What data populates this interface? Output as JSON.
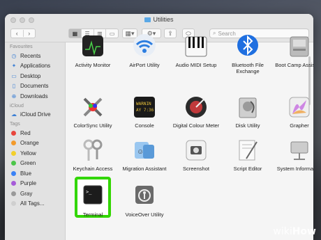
{
  "window": {
    "title": "Utilities",
    "search_placeholder": "Search"
  },
  "toolbar": {
    "back_label": "‹",
    "forward_label": "›",
    "view_icons": [
      "▦",
      "☰",
      "▥",
      "▭"
    ],
    "group_label": "▦▾",
    "action_label": "⚙▾",
    "share_label": "⇪",
    "tag_label": "⬭"
  },
  "sidebar": {
    "favourites_heading": "Favourites",
    "favourites": [
      {
        "label": "Recents",
        "icon": "clock-icon"
      },
      {
        "label": "Applications",
        "icon": "applications-icon"
      },
      {
        "label": "Desktop",
        "icon": "desktop-icon"
      },
      {
        "label": "Documents",
        "icon": "document-icon"
      },
      {
        "label": "Downloads",
        "icon": "download-icon"
      }
    ],
    "icloud_heading": "iCloud",
    "icloud": [
      {
        "label": "iCloud Drive",
        "icon": "cloud-icon"
      }
    ],
    "tags_heading": "Tags",
    "tags": [
      {
        "label": "Red",
        "color": "#e8453c"
      },
      {
        "label": "Orange",
        "color": "#f39a2b"
      },
      {
        "label": "Yellow",
        "color": "#f3cf2b"
      },
      {
        "label": "Green",
        "color": "#4cc64a"
      },
      {
        "label": "Blue",
        "color": "#3a82f6"
      },
      {
        "label": "Purple",
        "color": "#a65bd8"
      },
      {
        "label": "Gray",
        "color": "#9a9a9a"
      },
      {
        "label": "All Tags...",
        "color": "#cfcfcf"
      }
    ]
  },
  "apps": [
    {
      "label": "Activity Monitor",
      "icon": "activity-monitor-icon"
    },
    {
      "label": "AirPort Utility",
      "icon": "wifi-icon"
    },
    {
      "label": "Audio MIDI Setup",
      "icon": "piano-keyboard-icon"
    },
    {
      "label": "Bluetooth File Exchange",
      "icon": "bluetooth-icon"
    },
    {
      "label": "Boot Camp Assistant",
      "icon": "boot-camp-icon"
    },
    {
      "label": "ColorSync Utility",
      "icon": "colorsync-icon"
    },
    {
      "label": "Console",
      "icon": "console-icon",
      "screen_text": "WARNIN\nAY 7:36"
    },
    {
      "label": "Digital Colour Meter",
      "icon": "colour-meter-icon"
    },
    {
      "label": "Disk Utility",
      "icon": "disk-utility-icon"
    },
    {
      "label": "Grapher",
      "icon": "grapher-icon"
    },
    {
      "label": "Keychain Access",
      "icon": "keychain-icon"
    },
    {
      "label": "Migration Assistant",
      "icon": "migration-icon"
    },
    {
      "label": "Screenshot",
      "icon": "screenshot-icon"
    },
    {
      "label": "Script Editor",
      "icon": "script-editor-icon"
    },
    {
      "label": "System Information",
      "icon": "system-information-icon"
    },
    {
      "label": "Terminal",
      "icon": "terminal-icon",
      "screen_text": ">_"
    },
    {
      "label": "VoiceOver Utility",
      "icon": "voiceover-icon"
    }
  ],
  "colors": {
    "highlight": "#32d600",
    "sidebar_accent": "#3b7fd4"
  },
  "watermark": {
    "wiki": "wiki",
    "how": "How"
  }
}
